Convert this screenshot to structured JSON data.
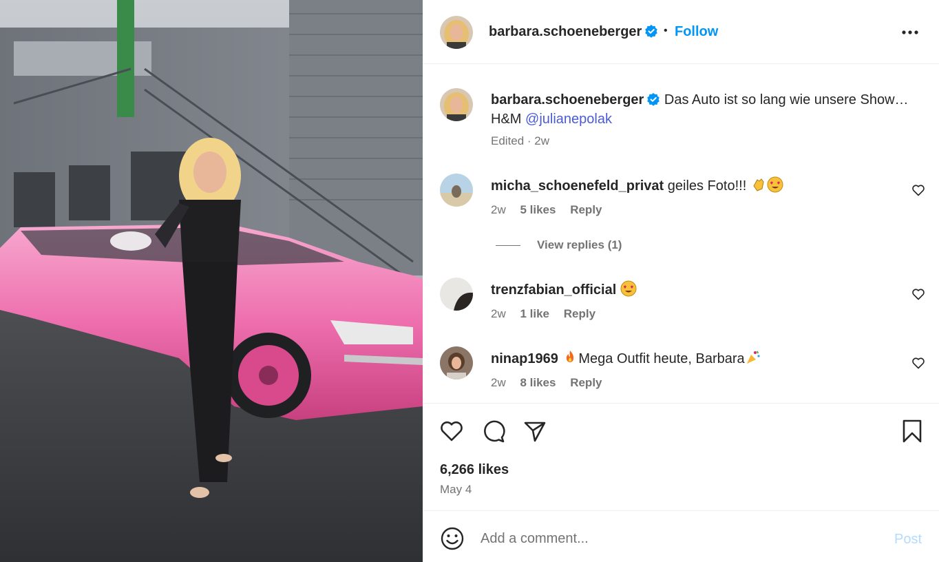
{
  "post": {
    "author": "barbara.schoeneberger",
    "follow_label": "Follow",
    "separator": "•",
    "photo_description": "pink-limousine-photo"
  },
  "caption": {
    "author": "barbara.schoeneberger",
    "text": "Das Auto ist so lang wie unsere Show…",
    "line2_prefix": "H&M",
    "mention": "@julianepolak",
    "meta": "Edited · 2w"
  },
  "comments": [
    {
      "user": "micha_schoenefeld_privat",
      "text": "geiles Foto!!!",
      "emojis": [
        "clapping-hands-emoji",
        "heart-eyes-emoji"
      ],
      "age": "2w",
      "likes": "5 likes",
      "reply": "Reply"
    },
    {
      "user": "trenzfabian_official",
      "text": "",
      "emojis": [
        "heart-eyes-emoji"
      ],
      "age": "2w",
      "likes": "1 like",
      "reply": "Reply"
    },
    {
      "user": "ninap1969",
      "text": "Mega Outfit heute, Barbara",
      "emojis": [
        "fire-emoji",
        "party-popper-emoji"
      ],
      "age": "2w",
      "likes": "8 likes",
      "reply": "Reply"
    }
  ],
  "view_replies": "View replies (1)",
  "actions": {
    "icons": [
      "heart-icon",
      "comment-icon",
      "share-icon",
      "bookmark-icon"
    ],
    "likes": "6,266 likes",
    "date": "May 4"
  },
  "add_comment": {
    "placeholder": "Add a comment...",
    "post_label": "Post"
  },
  "colors": {
    "accent": "#0095f6",
    "mention": "#4a5bd4",
    "muted": "#737373",
    "verified": "#0095f6",
    "post_disabled": "#b3dbff"
  }
}
